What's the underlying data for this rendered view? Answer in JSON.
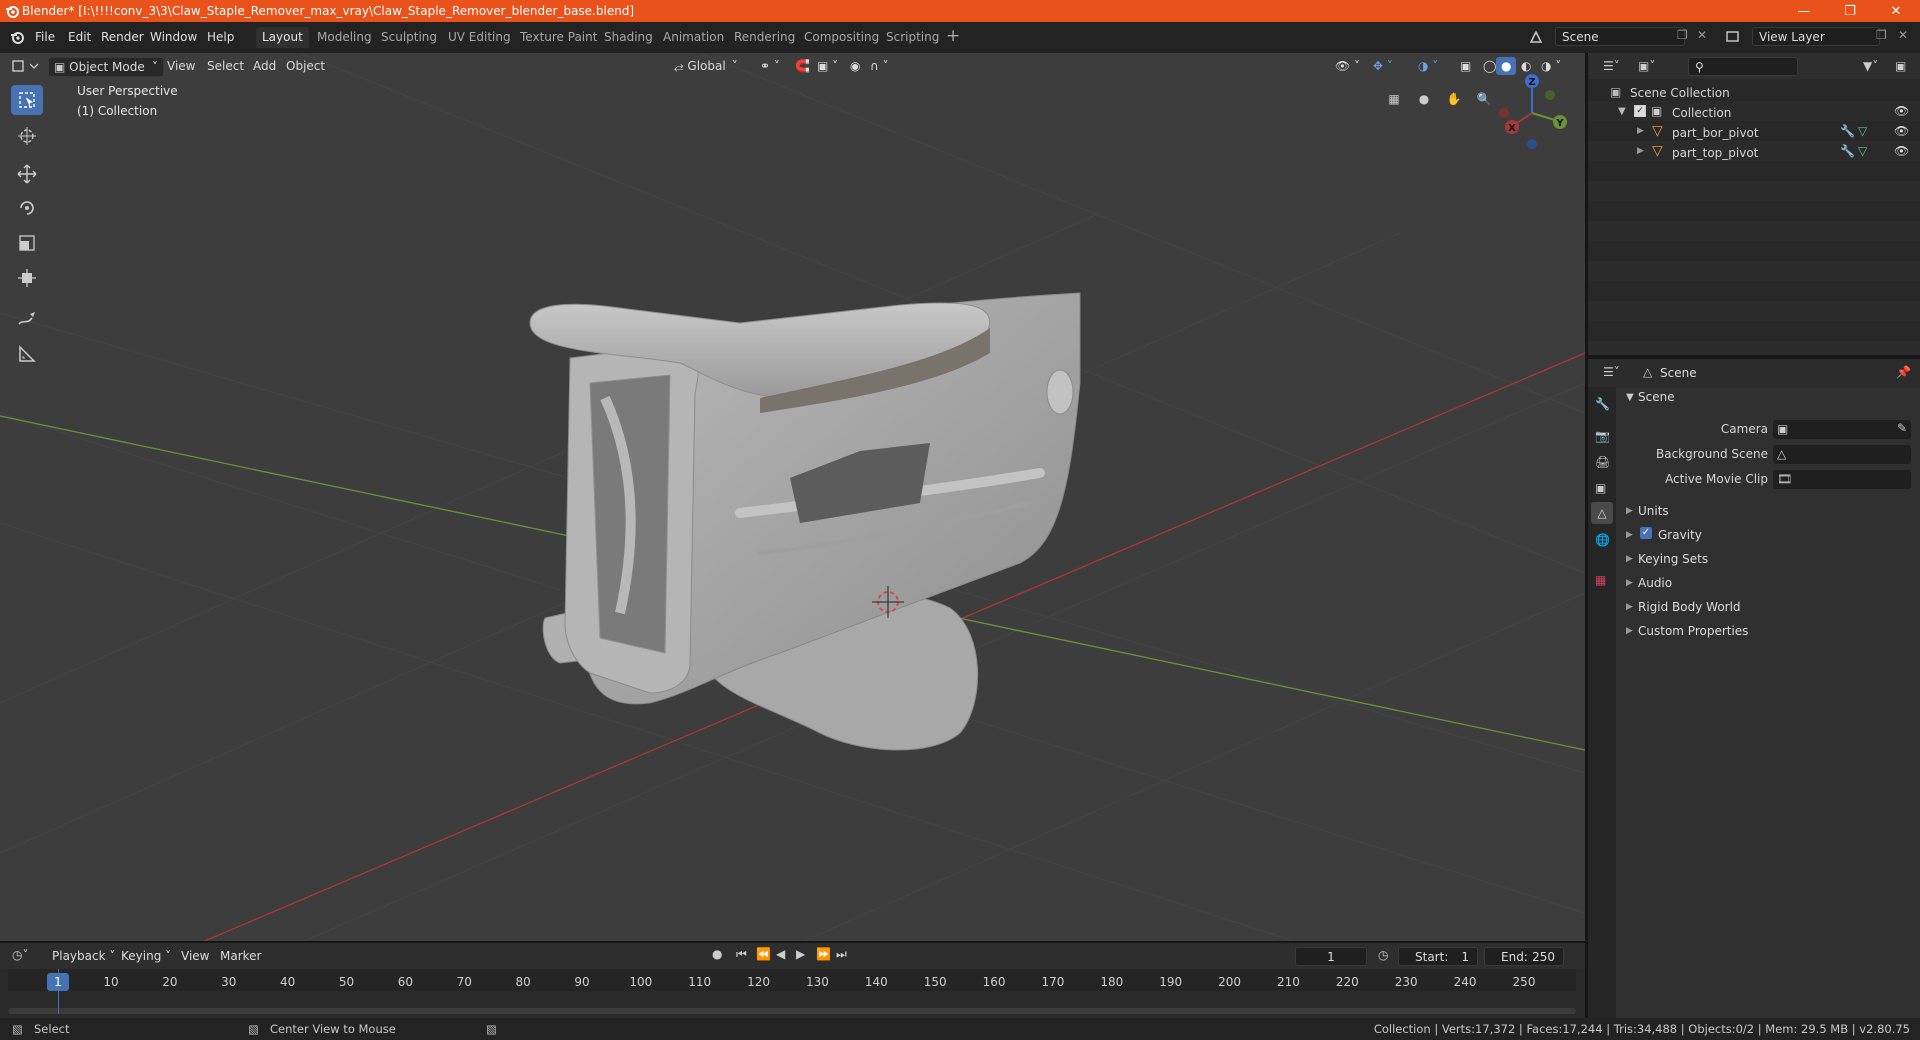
{
  "window": {
    "title": "Blender* [I:\\!!!!conv_3\\3\\Claw_Staple_Remover_max_vray\\Claw_Staple_Remover_blender_base.blend]",
    "controls": [
      "minimize-icon",
      "maximize-icon",
      "close-icon"
    ]
  },
  "menu": {
    "file": "File",
    "edit": "Edit",
    "render": "Render",
    "window": "Window",
    "help": "Help"
  },
  "workspaces": [
    "Layout",
    "Modeling",
    "Sculpting",
    "UV Editing",
    "Texture Paint",
    "Shading",
    "Animation",
    "Rendering",
    "Compositing",
    "Scripting"
  ],
  "active_workspace": "Layout",
  "scene_selector": {
    "value": "Scene"
  },
  "view_layer_selector": {
    "value": "View Layer"
  },
  "viewport_header": {
    "mode": "Object Mode",
    "view": "View",
    "select": "Select",
    "add": "Add",
    "object": "Object",
    "orientation": "Global"
  },
  "viewport": {
    "perspective_label": "User Perspective",
    "collection_label": "(1) Collection",
    "gizmo_axes": {
      "x": "X",
      "y": "Y",
      "z": "Z"
    }
  },
  "tools": [
    "select-box-icon",
    "cursor-icon",
    "move-icon",
    "rotate-icon",
    "scale-icon",
    "transform-icon",
    "annotate-icon",
    "measure-icon"
  ],
  "outliner": {
    "root": "Scene Collection",
    "collection": "Collection",
    "items": [
      {
        "name": "part_bor_pivot"
      },
      {
        "name": "part_top_pivot"
      }
    ]
  },
  "properties": {
    "context": "Scene",
    "panel_title": "Scene",
    "fields": [
      {
        "label": "Camera"
      },
      {
        "label": "Background Scene"
      },
      {
        "label": "Active Movie Clip"
      }
    ],
    "sections": [
      {
        "label": "Units",
        "checkbox": false
      },
      {
        "label": "Gravity",
        "checkbox": true
      },
      {
        "label": "Keying Sets",
        "checkbox": false
      },
      {
        "label": "Audio",
        "checkbox": false
      },
      {
        "label": "Rigid Body World",
        "checkbox": false
      },
      {
        "label": "Custom Properties",
        "checkbox": false
      }
    ]
  },
  "timeline": {
    "playback": "Playback",
    "keying": "Keying",
    "view": "View",
    "marker": "Marker",
    "current_frame": "1",
    "start_label": "Start:",
    "start": "1",
    "end_label": "End:",
    "end": "250",
    "ticks": [
      "1",
      "10",
      "20",
      "30",
      "40",
      "50",
      "60",
      "70",
      "80",
      "90",
      "100",
      "110",
      "120",
      "130",
      "140",
      "150",
      "160",
      "170",
      "180",
      "190",
      "200",
      "210",
      "220",
      "230",
      "240",
      "250"
    ]
  },
  "statusbar": {
    "select": "Select",
    "center_view": "Center View to Mouse",
    "stats": "Collection | Verts:17,372 | Faces:17,244 | Tris:34,488 | Objects:0/2 | Mem: 29.5 MB | v2.80.75"
  },
  "colors": {
    "titlebar": "#e9521b",
    "accent": "#4772b3",
    "x_axis": "#a8383c",
    "y_axis": "#6c9236",
    "z_axis": "#3c6fcc"
  }
}
